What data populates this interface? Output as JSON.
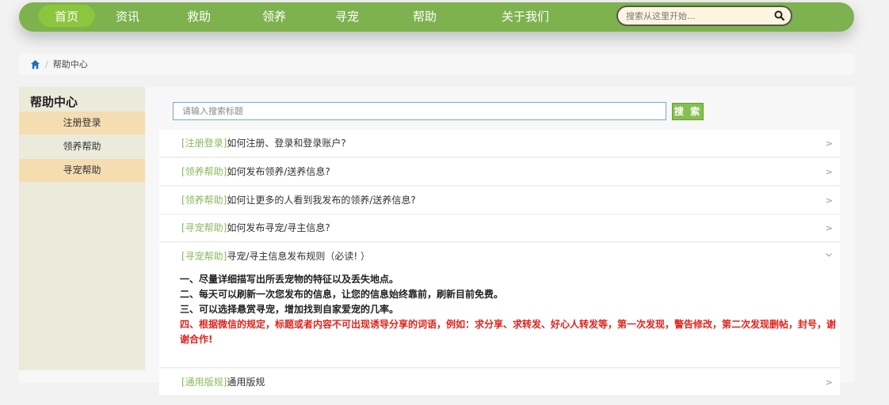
{
  "nav": {
    "items": [
      {
        "label": "首页",
        "active": true
      },
      {
        "label": "资讯"
      },
      {
        "label": "救助"
      },
      {
        "label": "领养"
      },
      {
        "label": "寻宠"
      },
      {
        "label": "帮助"
      },
      {
        "label": "关于我们"
      }
    ],
    "search_placeholder": "搜索从这里开始..."
  },
  "breadcrumb": {
    "current": "帮助中心"
  },
  "sidebar": {
    "title": "帮助中心",
    "items": [
      {
        "label": "注册登录"
      },
      {
        "label": "领养帮助"
      },
      {
        "label": "寻宠帮助"
      }
    ]
  },
  "main": {
    "search_placeholder": "请输入搜索标题",
    "search_button": "搜 索",
    "faqs": [
      {
        "tag": "[注册登录]",
        "question": "如何注册、登录和登录账户?"
      },
      {
        "tag": "[领养帮助]",
        "question": "如何发布领养/送养信息?"
      },
      {
        "tag": "[领养帮助]",
        "question": "如何让更多的人看到我发布的领养/送养信息?"
      },
      {
        "tag": "[寻宠帮助]",
        "question": "如何发布寻宠/寻主信息?"
      },
      {
        "tag": "[寻宠帮助]",
        "question": "寻宠/寻主信息发布规则（必读! ）"
      },
      {
        "tag": "[通用版规]",
        "question": "通用版规"
      }
    ],
    "answer_lines": [
      "一、尽量详细描写出所丢宠物的特征以及丢失地点。",
      "二、每天可以刷新一次您发布的信息，让您的信息始终靠前，刷新目前免费。",
      "三、可以选择悬赏寻宠，增加找到自家爱宠的几率。"
    ],
    "answer_warning": "四、根据微信的规定，标题或者内容不可出现诱导分享的词语，例如：求分享、求转发、好心人转发等，第一次发现，警告修改，第二次发现删帖，封号，谢谢合作!"
  },
  "colors": {
    "nav_bg": "#7db24e",
    "nav_active": "#8cc63f",
    "tag_green": "#8aba5c",
    "warning_red": "#e1221c",
    "sidebar_highlight": "#f6dcb1"
  }
}
